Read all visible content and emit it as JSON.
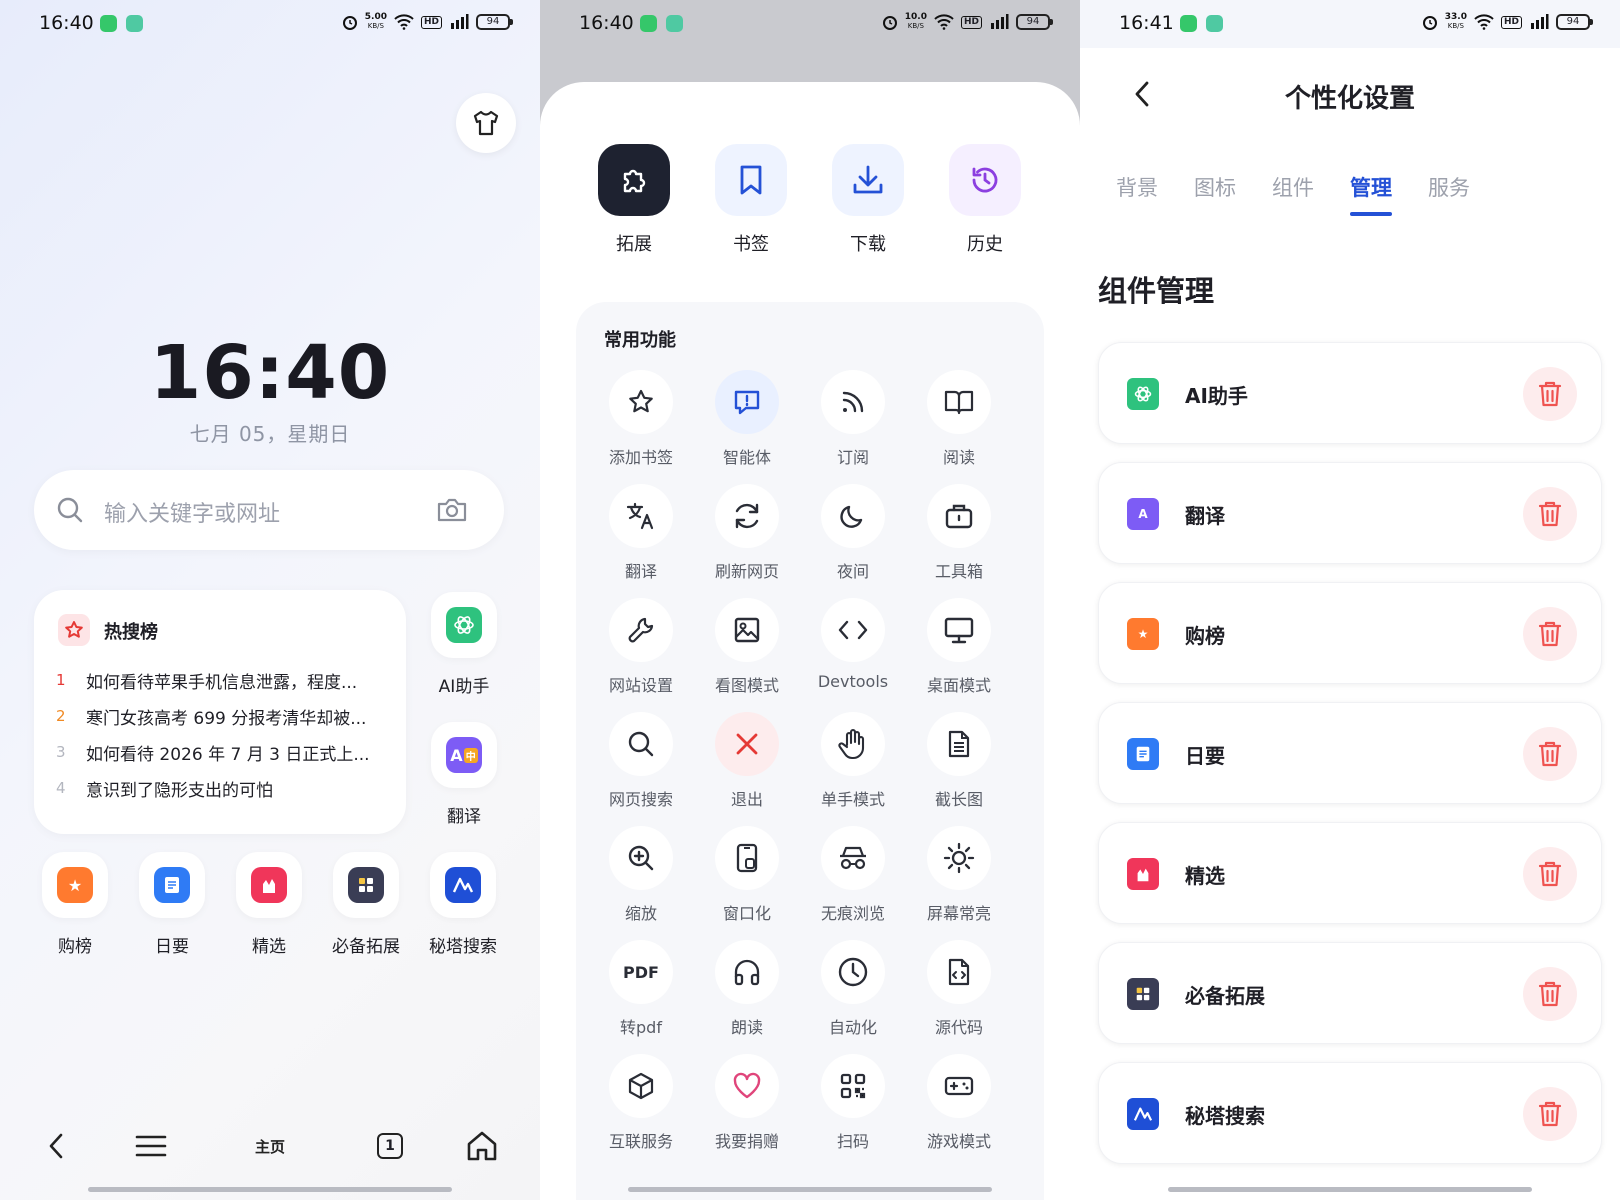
{
  "status_bars": [
    {
      "time": "16:40",
      "speed": "5.00",
      "speed_unit": "KB/S",
      "hd": "HD",
      "net": "4G",
      "battery": "94"
    },
    {
      "time": "16:40",
      "speed": "10.0",
      "speed_unit": "KB/S",
      "hd": "HD",
      "net": "4G",
      "battery": "94"
    },
    {
      "time": "16:41",
      "speed": "33.0",
      "speed_unit": "KB/S",
      "hd": "HD",
      "net": "4G",
      "battery": "94"
    }
  ],
  "home": {
    "clock": "16:40",
    "date": "七月 05，星期日",
    "search_placeholder": "输入关键字或网址",
    "hot": {
      "title": "热搜榜",
      "items": [
        {
          "rank": "1",
          "text": "如何看待苹果手机信息泄露，程度..."
        },
        {
          "rank": "2",
          "text": "寒门女孩高考 699 分报考清华却被..."
        },
        {
          "rank": "3",
          "text": "如何看待 2026 年 7 月 3 日正式上..."
        },
        {
          "rank": "4",
          "text": "意识到了隐形支出的可怕"
        }
      ]
    },
    "side_apps": [
      {
        "label": "AI助手",
        "icon": "ai-assistant-icon",
        "color": "#2ec27e"
      },
      {
        "label": "翻译",
        "icon": "translate-icon",
        "color": "#7d5cf5"
      }
    ],
    "bottom_apps": [
      {
        "label": "购榜",
        "icon": "shopping-rank-icon",
        "color": "#ff7a2f"
      },
      {
        "label": "日要",
        "icon": "daily-news-icon",
        "color": "#2f7bf5"
      },
      {
        "label": "精选",
        "icon": "featured-icon",
        "color": "#f0365a"
      },
      {
        "label": "必备拓展",
        "icon": "essential-extensions-icon",
        "color": "#3a3d55"
      },
      {
        "label": "秘塔搜索",
        "icon": "metaso-search-icon",
        "color": "#1f4fd6"
      }
    ],
    "nav": {
      "home_label": "主页",
      "tab_count": "1"
    }
  },
  "menu": {
    "top_actions": [
      {
        "label": "拓展",
        "icon": "puzzle-icon",
        "bg": "#1e2230",
        "fg": "#ffffff"
      },
      {
        "label": "书签",
        "icon": "bookmark-icon",
        "bg": "#eef3ff",
        "fg": "#2451d6"
      },
      {
        "label": "下载",
        "icon": "download-icon",
        "bg": "#eef3ff",
        "fg": "#2451d6"
      },
      {
        "label": "历史",
        "icon": "history-icon",
        "bg": "#f5efff",
        "fg": "#8c3fe0"
      }
    ],
    "section_title": "常用功能",
    "functions": [
      {
        "label": "添加书签",
        "icon": "star-icon"
      },
      {
        "label": "智能体",
        "icon": "agent-icon"
      },
      {
        "label": "订阅",
        "icon": "rss-icon"
      },
      {
        "label": "阅读",
        "icon": "book-icon"
      },
      {
        "label": "翻译",
        "icon": "translate-icon"
      },
      {
        "label": "刷新网页",
        "icon": "refresh-icon"
      },
      {
        "label": "夜间",
        "icon": "moon-icon"
      },
      {
        "label": "工具箱",
        "icon": "toolbox-icon"
      },
      {
        "label": "网站设置",
        "icon": "wrench-icon"
      },
      {
        "label": "看图模式",
        "icon": "image-icon"
      },
      {
        "label": "Devtools",
        "icon": "code-icon"
      },
      {
        "label": "桌面模式",
        "icon": "monitor-icon"
      },
      {
        "label": "网页搜索",
        "icon": "search-icon"
      },
      {
        "label": "退出",
        "icon": "close-icon"
      },
      {
        "label": "单手模式",
        "icon": "hand-icon"
      },
      {
        "label": "截长图",
        "icon": "document-icon"
      },
      {
        "label": "缩放",
        "icon": "zoom-in-icon"
      },
      {
        "label": "窗口化",
        "icon": "window-icon"
      },
      {
        "label": "无痕浏览",
        "icon": "incognito-icon"
      },
      {
        "label": "屏幕常亮",
        "icon": "sun-icon"
      },
      {
        "label": "转pdf",
        "icon": "pdf-icon",
        "glyph": "PDF"
      },
      {
        "label": "朗读",
        "icon": "headphones-icon"
      },
      {
        "label": "自动化",
        "icon": "clock-icon"
      },
      {
        "label": "源代码",
        "icon": "source-code-icon"
      },
      {
        "label": "互联服务",
        "icon": "cube-icon"
      },
      {
        "label": "我要捐赠",
        "icon": "heart-icon"
      },
      {
        "label": "扫码",
        "icon": "qr-scan-icon"
      },
      {
        "label": "游戏模式",
        "icon": "gamepad-icon"
      }
    ]
  },
  "settings": {
    "title": "个性化设置",
    "tabs": [
      "背景",
      "图标",
      "组件",
      "管理",
      "服务"
    ],
    "active_tab": "管理",
    "section_title": "组件管理",
    "widgets": [
      {
        "name": "AI助手",
        "color": "#2ec27e"
      },
      {
        "name": "翻译",
        "color": "#7d5cf5"
      },
      {
        "name": "购榜",
        "color": "#ff7a2f"
      },
      {
        "name": "日要",
        "color": "#2f7bf5"
      },
      {
        "name": "精选",
        "color": "#f0365a"
      },
      {
        "name": "必备拓展",
        "color": "#3a3d55"
      },
      {
        "name": "秘塔搜索",
        "color": "#1f4fd6"
      }
    ]
  }
}
